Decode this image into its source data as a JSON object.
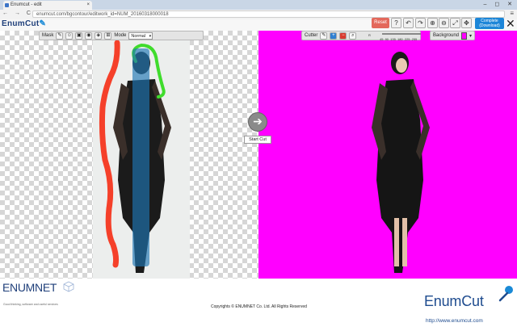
{
  "browser": {
    "tab_title": "Enumcut - edit",
    "tab_close": "×",
    "window_controls": "– ◻ ✕",
    "nav_buttons": "← → C",
    "url": "enumcut.com/bgcontour/editwork_id=NUM_20160318000018",
    "menu_icon": "≡"
  },
  "app": {
    "logo": "EnumCut",
    "logo_pen": "✎"
  },
  "mask_toolbar": {
    "label": "Mask",
    "mode_label": "Mode",
    "mode_value": "Normal",
    "icons": [
      "brush-icon",
      "person-icon",
      "bbox-icon",
      "fg-icon",
      "fill-icon",
      "grid-icon"
    ]
  },
  "cutter_toolbar": {
    "label": "Cutter",
    "slider_label": "R",
    "slider_ticks": [
      "45",
      "90",
      "135",
      "180",
      "225",
      "255"
    ]
  },
  "background_toolbar": {
    "label": "Background",
    "color": "#ff00ff"
  },
  "top_buttons": {
    "reset": "Reset",
    "help": "?",
    "undo": "↶",
    "redo": "↷",
    "zoom_in": "⊕",
    "zoom_out": "⊖",
    "fit": "⤢",
    "move": "✥",
    "complete_line1": "Complete",
    "complete_line2": "(Download)",
    "close": "✕"
  },
  "start": {
    "arrow": "➔",
    "label": "Start Cut"
  },
  "colors": {
    "brand": "#1f3f7a",
    "accent": "#1c86d8",
    "reset": "#e3685b",
    "cut_background": "#ff00ff",
    "mask_red": "#f5402a",
    "mask_green": "#3fdc2c",
    "mask_blue": "#1f77b4"
  },
  "footer": {
    "company_logo": "ENUMNET",
    "company_tag": "Good thinking, software and useful services",
    "copyright": "Copyrights © ENUMNET Co. Ltd. All Rights Reserved",
    "product_logo": "EnumCut",
    "website": "http://www.enumcut.com"
  }
}
